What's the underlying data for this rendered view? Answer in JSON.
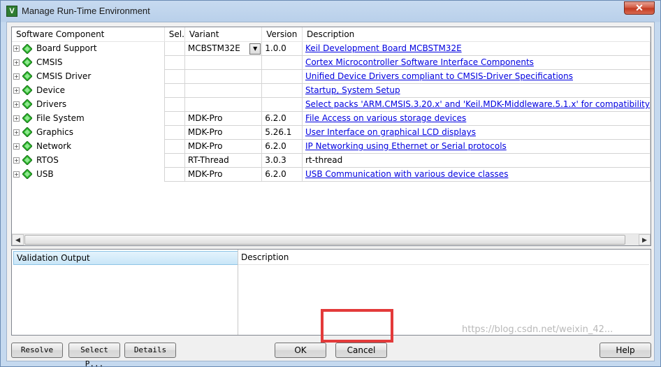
{
  "window": {
    "title": "Manage Run-Time Environment",
    "close_label": "✕"
  },
  "components_table": {
    "headers": {
      "component": "Software Component",
      "sel": "Sel.",
      "variant": "Variant",
      "version": "Version",
      "description": "Description"
    },
    "rows": [
      {
        "component": "Board Support",
        "sel": "",
        "variant": "MCBSTM32E",
        "version": "1.0.0",
        "description": "Keil Development Board MCBSTM32E",
        "link": true
      },
      {
        "component": "CMSIS",
        "sel": "",
        "variant": "",
        "version": "",
        "description": "Cortex Microcontroller Software Interface Components",
        "link": true
      },
      {
        "component": "CMSIS Driver",
        "sel": "",
        "variant": "",
        "version": "",
        "description": "Unified Device Drivers compliant to CMSIS-Driver Specifications",
        "link": true
      },
      {
        "component": "Device",
        "sel": "",
        "variant": "",
        "version": "",
        "description": "Startup, System Setup",
        "link": true
      },
      {
        "component": "Drivers",
        "sel": "",
        "variant": "",
        "version": "",
        "description": "Select packs 'ARM.CMSIS.3.20.x' and 'Keil.MDK-Middleware.5.1.x' for compatibility",
        "link": true
      },
      {
        "component": "File System",
        "sel": "",
        "variant": "MDK-Pro",
        "version": "6.2.0",
        "description": "File Access on various storage devices",
        "link": true
      },
      {
        "component": "Graphics",
        "sel": "",
        "variant": "MDK-Pro",
        "version": "5.26.1",
        "description": "User Interface on graphical LCD displays",
        "link": true
      },
      {
        "component": "Network",
        "sel": "",
        "variant": "MDK-Pro",
        "version": "6.2.0",
        "description": "IP Networking using Ethernet or Serial protocols",
        "link": true
      },
      {
        "component": "RTOS",
        "sel": "",
        "variant": "RT-Thread",
        "version": "3.0.3",
        "description": "rt-thread",
        "link": false
      },
      {
        "component": "USB",
        "sel": "",
        "variant": "MDK-Pro",
        "version": "6.2.0",
        "description": "USB Communication with various device classes",
        "link": true
      }
    ]
  },
  "validation": {
    "output_header": "Validation Output",
    "description_header": "Description"
  },
  "buttons": {
    "resolve": "Resolve",
    "select_packs": "Select P...",
    "details": "Details",
    "ok": "OK",
    "cancel": "Cancel",
    "help": "Help"
  },
  "watermark": "https://blog.csdn.net/weixin_42...",
  "colors": {
    "link": "#0000e0",
    "highlight": "#e33a3a",
    "component_icon": "#2eb82e"
  }
}
